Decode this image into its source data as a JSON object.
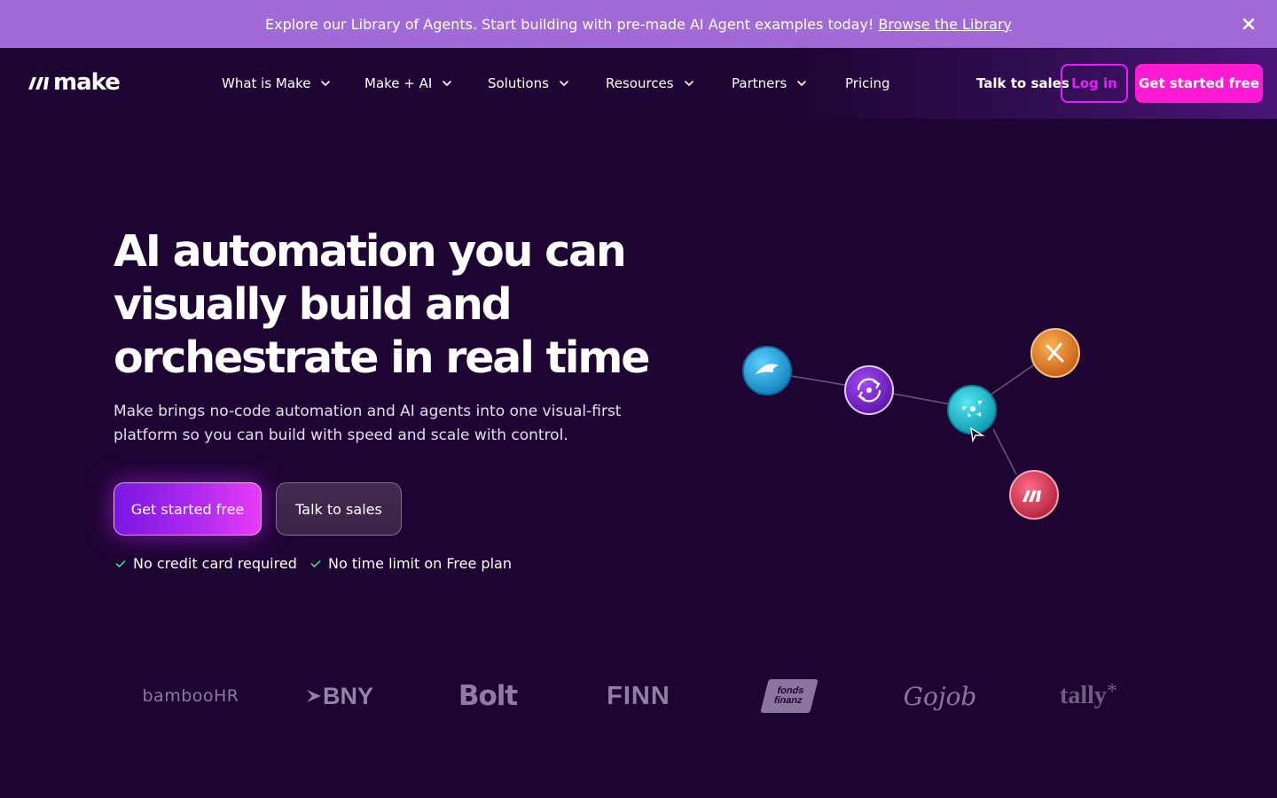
{
  "banner": {
    "text": "Explore our Library of Agents. Start building with pre-made AI Agent examples today!",
    "link": "Browse the Library",
    "close_icon": "close-icon"
  },
  "header": {
    "logo_text": "make",
    "nav": [
      {
        "label": "What is Make",
        "has_dropdown": true
      },
      {
        "label": "Make + AI",
        "has_dropdown": true
      },
      {
        "label": "Solutions",
        "has_dropdown": true
      },
      {
        "label": "Resources",
        "has_dropdown": true
      },
      {
        "label": "Partners",
        "has_dropdown": true
      },
      {
        "label": "Pricing",
        "has_dropdown": false
      }
    ],
    "talk_to_sales": "Talk to sales",
    "log_in": "Log in",
    "get_started": "Get started free"
  },
  "hero": {
    "title_lines": [
      "AI automation you can",
      "visually build and",
      "orchestrate in real time"
    ],
    "subtitle_lines": [
      "Make brings no-code automation and AI agents into one visual-first",
      "platform so you can build with speed and scale with control."
    ],
    "primary_cta": "Get started free",
    "secondary_cta": "Talk to sales",
    "checks": [
      "No credit card required",
      "No time limit on Free plan"
    ]
  },
  "diagram": {
    "nodes": [
      {
        "name": "blue-app-node",
        "icon": "bird-icon",
        "color": "#1aa3d9"
      },
      {
        "name": "purple-app-node",
        "icon": "sync-icon",
        "color": "#7c1fd1"
      },
      {
        "name": "teal-app-node",
        "icon": "expand-icon",
        "color": "#11b5c9"
      },
      {
        "name": "orange-app-node",
        "icon": "tools-icon",
        "color": "#e07a1f"
      },
      {
        "name": "red-app-node",
        "icon": "make-icon",
        "color": "#d63a58"
      }
    ]
  },
  "logos": [
    "bambooHR",
    "BNY",
    "Bolt",
    "FINN",
    "fonds finanz",
    "Gojob",
    "tally"
  ],
  "colors": {
    "background": "#1e0433",
    "banner": "#a26ad6",
    "accent_pink": "#ff1ad4",
    "accent_magenta": "#e81cff"
  }
}
